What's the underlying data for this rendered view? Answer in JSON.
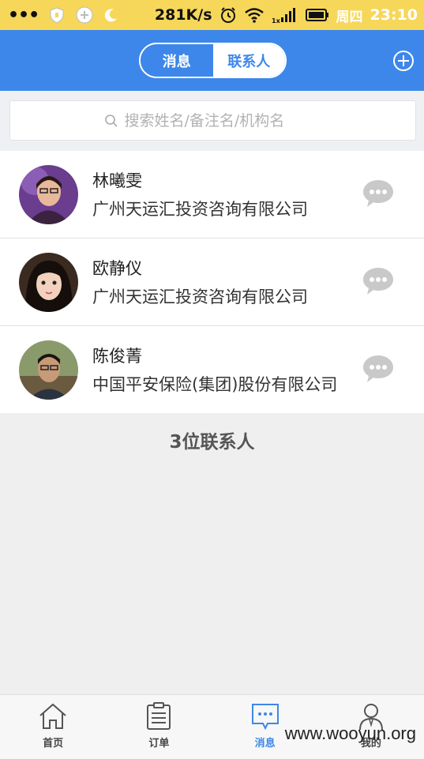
{
  "status_bar": {
    "speed": "281K/s",
    "network": "1x",
    "day": "周四",
    "time": "23:10",
    "icons": [
      "more-dots-icon",
      "shield-icon",
      "plus-circle-icon",
      "moon-icon",
      "alarm-icon",
      "wifi-icon",
      "signal-icon",
      "battery-icon"
    ]
  },
  "header": {
    "tabs": [
      {
        "label": "消息",
        "active": false
      },
      {
        "label": "联系人",
        "active": true
      }
    ],
    "add_icon": "plus-circle-icon",
    "accent": "#3d87ea"
  },
  "search": {
    "placeholder": "搜索姓名/备注名/机构名",
    "icon": "search-icon"
  },
  "contacts": [
    {
      "name": "林曦雯",
      "company": "广州天运汇投资咨询有限公司"
    },
    {
      "name": "欧静仪",
      "company": "广州天运汇投资咨询有限公司"
    },
    {
      "name": "陈俊菁",
      "company": "中国平安保险(集团)股份有限公司"
    }
  ],
  "contact_count": "3位联系人",
  "tabbar": {
    "items": [
      {
        "label": "首页",
        "icon": "home-icon",
        "active": false
      },
      {
        "label": "订单",
        "icon": "clipboard-icon",
        "active": false
      },
      {
        "label": "消息",
        "icon": "message-icon",
        "active": true
      },
      {
        "label": "我的",
        "icon": "person-icon",
        "active": false
      }
    ]
  },
  "watermark": "www.wooyun.org"
}
